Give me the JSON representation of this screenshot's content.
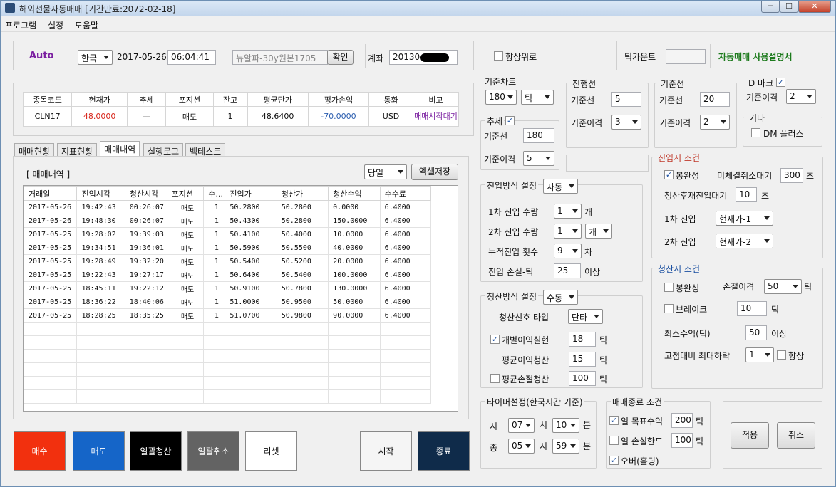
{
  "window": {
    "title": "해외선물자동매매 [기간만료:2072-02-18]",
    "min": "─",
    "max": "☐",
    "close": "✕"
  },
  "menu": [
    "프로그램",
    "설정",
    "도움말"
  ],
  "top": {
    "mode": "Auto",
    "country": "한국",
    "date": "2017-05-26",
    "time": "06:04:41",
    "product": "뉴알파-30y원본1705",
    "confirm": "확인",
    "account_label": "계좌",
    "account_value": "20130",
    "upward_label": "향상위로",
    "tick_count_label": "틱카운트",
    "tick_count_value": "",
    "manual_link": "자동매매 사용설명서"
  },
  "position": {
    "headers": [
      "종목코드",
      "현재가",
      "추세",
      "포지션",
      "잔고",
      "평균단가",
      "평가손익",
      "통화",
      "비고"
    ],
    "row": [
      "CLN17",
      "48.0000",
      "—",
      "매도",
      "1",
      "48.6400",
      "-70.0000",
      "USD",
      "매매시작대기"
    ]
  },
  "tabs": [
    "매매현황",
    "지표현황",
    "매매내역",
    "실행로그",
    "백테스트"
  ],
  "history": {
    "label": "[ 매매내역 ]",
    "period": "당일",
    "excel": "엑셀저장",
    "headers": [
      "거래일",
      "진입시각",
      "청산시각",
      "포지션",
      "수...",
      "진입가",
      "청산가",
      "청산손익",
      "수수료"
    ],
    "rows": [
      [
        "2017-05-26",
        "19:42:43",
        "00:26:07",
        "매도",
        "1",
        "50.2800",
        "50.2800",
        "0.0000",
        "6.4000"
      ],
      [
        "2017-05-26",
        "19:48:30",
        "00:26:07",
        "매도",
        "1",
        "50.4300",
        "50.2800",
        "150.0000",
        "6.4000"
      ],
      [
        "2017-05-25",
        "19:28:02",
        "19:39:03",
        "매도",
        "1",
        "50.4100",
        "50.4000",
        "10.0000",
        "6.4000"
      ],
      [
        "2017-05-25",
        "19:34:51",
        "19:36:01",
        "매도",
        "1",
        "50.5900",
        "50.5500",
        "40.0000",
        "6.4000"
      ],
      [
        "2017-05-25",
        "19:28:49",
        "19:32:20",
        "매도",
        "1",
        "50.5400",
        "50.5200",
        "20.0000",
        "6.4000"
      ],
      [
        "2017-05-25",
        "19:22:43",
        "19:27:17",
        "매도",
        "1",
        "50.6400",
        "50.5400",
        "100.0000",
        "6.4000"
      ],
      [
        "2017-05-25",
        "18:45:11",
        "19:22:12",
        "매도",
        "1",
        "50.9100",
        "50.7800",
        "130.0000",
        "6.4000"
      ],
      [
        "2017-05-25",
        "18:36:22",
        "18:40:06",
        "매도",
        "1",
        "51.0000",
        "50.9500",
        "50.0000",
        "6.4000"
      ],
      [
        "2017-05-25",
        "18:28:25",
        "18:35:25",
        "매도",
        "1",
        "51.0700",
        "50.9800",
        "90.0000",
        "6.4000"
      ]
    ]
  },
  "buttons": {
    "buy": "매수",
    "sell": "매도",
    "close_all": "일괄청산",
    "cancel_all": "일괄취소",
    "reset": "리셋",
    "start": "시작",
    "stop": "종료",
    "apply": "적용",
    "cancel": "취소"
  },
  "chart": {
    "title": "기준차트",
    "period": "180",
    "unit": "틱"
  },
  "trend": {
    "title": "추세",
    "base_label": "기준선",
    "base": "180",
    "gap_label": "기준이격",
    "gap": "5"
  },
  "lead": {
    "title": "진행선",
    "base_label": "기준선",
    "base": "5",
    "gap_label": "기준이격",
    "gap": "3"
  },
  "baseline": {
    "title": "기준선",
    "base_label": "기준선",
    "base": "20",
    "gap_label": "기준이격",
    "gap": "2"
  },
  "dmark": {
    "title": "D 마크",
    "gap_label": "기준이격",
    "gap": "2"
  },
  "etc": {
    "title": "기타",
    "dm_label": "DM 플러스"
  },
  "entry": {
    "title": "진입방식 설정",
    "mode": "자동",
    "q1_label": "1차 진입 수량",
    "q1": "1",
    "q1_unit": "개",
    "q2_label": "2차 진입 수량",
    "q2": "1",
    "q2_unit": "개",
    "cum_label": "누적진입 횟수",
    "cum": "9",
    "cum_unit": "차",
    "loss_label": "진입 손실-틱",
    "loss": "25",
    "loss_unit": "이상"
  },
  "exit": {
    "title": "청산방식 설정",
    "mode": "수동",
    "signal_label": "청산신호 타입",
    "signal": "단타",
    "indiv_label": "개별이익실현",
    "indiv": "18",
    "avg_label": "평균이익청산",
    "avg": "15",
    "avgloss_label": "평균손절청산",
    "avgloss": "100",
    "tick": "틱"
  },
  "entry_cond": {
    "title": "진입시 조건",
    "complete_label": "봉완성",
    "unfilled_label": "미체결취소대기",
    "unfilled": "300",
    "sec": "초",
    "reentry_label": "청산후재진입대기",
    "reentry": "10",
    "e1_label": "1차 진입",
    "e1": "현재가-1",
    "e2_label": "2차 진입",
    "e2": "현재가-2"
  },
  "exit_cond": {
    "title": "청산시 조건",
    "complete_label": "봉완성",
    "stop_label": "손절이격",
    "stop": "50",
    "tick": "틱",
    "brake_label": "브레이크",
    "brake": "10",
    "minprofit_label": "최소수익(틱)",
    "minprofit": "50",
    "above": "이상",
    "drop_label": "고점대비 최대하락",
    "drop": "1",
    "improve_label": "향상"
  },
  "timer": {
    "title": "타이머설정(한국시간 기준)",
    "start_label": "시",
    "start_h": "07",
    "h": "시",
    "start_m": "10",
    "m": "분",
    "end_label": "종",
    "end_h": "05",
    "end_m": "59"
  },
  "end_cond": {
    "title": "매매종료 조건",
    "target_label": "일 목표수익",
    "target": "200",
    "loss_label": "일 손실한도",
    "loss": "100",
    "tick": "틱",
    "over_label": "오버(홀딩)"
  }
}
